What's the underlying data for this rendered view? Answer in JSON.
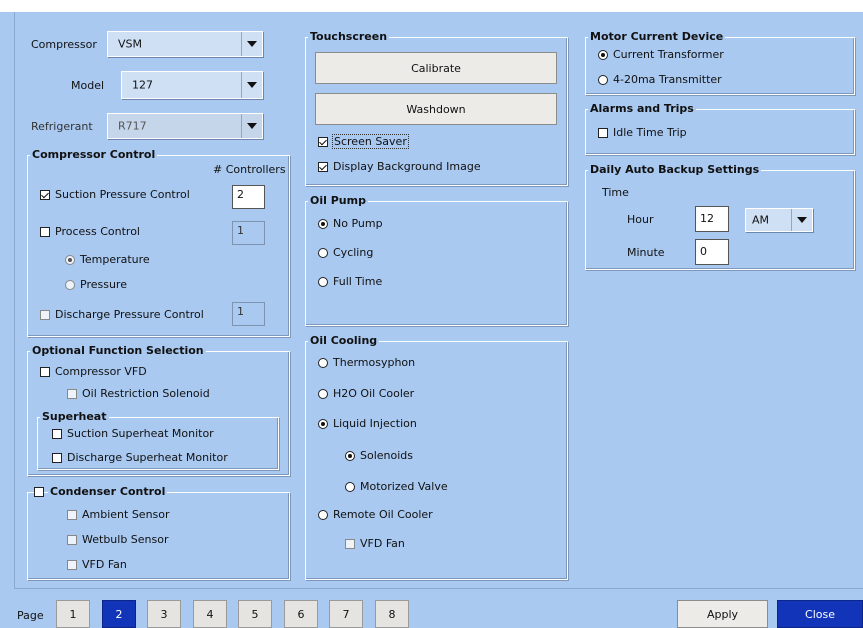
{
  "compressor": {
    "label": "Compressor",
    "value": "VSM",
    "model_label": "Model",
    "model_value": "127",
    "refrigerant_label": "Refrigerant",
    "refrigerant_value": "R717"
  },
  "compressor_control": {
    "title": "Compressor Control",
    "controllers_header": "# Controllers",
    "suction": {
      "label": "Suction Pressure Control",
      "value": "2"
    },
    "process": {
      "label": "Process Control",
      "value": "1",
      "temperature": "Temperature",
      "pressure": "Pressure"
    },
    "discharge": {
      "label": "Discharge Pressure Control",
      "value": "1"
    }
  },
  "optional": {
    "title": "Optional Function Selection",
    "vfd": "Compressor VFD",
    "oil_restriction": "Oil Restriction Solenoid",
    "superheat_title": "Superheat",
    "suction_superheat": "Suction Superheat Monitor",
    "discharge_superheat": "Discharge Superheat Monitor"
  },
  "condenser": {
    "title": "Condenser Control",
    "ambient": "Ambient Sensor",
    "wetbulb": "Wetbulb Sensor",
    "vfd_fan": "VFD Fan"
  },
  "touchscreen": {
    "title": "Touchscreen",
    "calibrate": "Calibrate",
    "washdown": "Washdown",
    "screen_saver": "Screen Saver",
    "background": "Display Background Image"
  },
  "oil_pump": {
    "title": "Oil Pump",
    "no_pump": "No Pump",
    "cycling": "Cycling",
    "full_time": "Full Time"
  },
  "oil_cooling": {
    "title": "Oil Cooling",
    "thermosyphon": "Thermosyphon",
    "h2o": "H2O Oil Cooler",
    "liquid_injection": "Liquid Injection",
    "solenoids": "Solenoids",
    "motorized_valve": "Motorized Valve",
    "remote": "Remote Oil Cooler",
    "vfd_fan": "VFD Fan"
  },
  "motor_current": {
    "title": "Motor Current Device",
    "ct": "Current Transformer",
    "transmitter": "4-20ma Transmitter"
  },
  "alarms": {
    "title": "Alarms and Trips",
    "idle": "Idle Time Trip"
  },
  "backup": {
    "title": "Daily Auto Backup Settings",
    "time_label": "Time",
    "hour_label": "Hour",
    "hour_value": "12",
    "ampm": "AM",
    "minute_label": "Minute",
    "minute_value": "0"
  },
  "footer": {
    "page_label": "Page",
    "pages": [
      "1",
      "2",
      "3",
      "4",
      "5",
      "6",
      "7",
      "8"
    ],
    "active_page": "2",
    "apply": "Apply",
    "close": "Close"
  }
}
